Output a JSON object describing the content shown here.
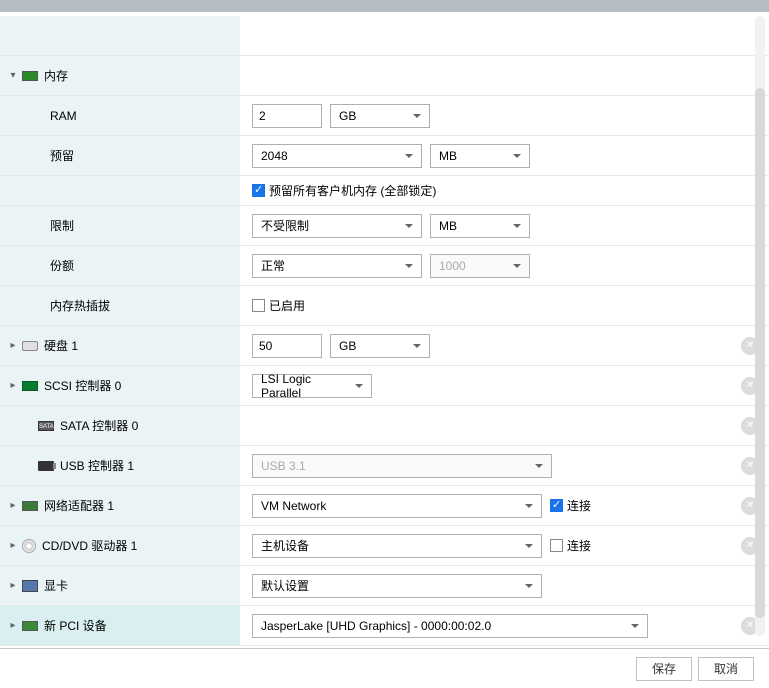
{
  "memory": {
    "label": "内存",
    "ram": {
      "label": "RAM",
      "value": "2",
      "unit": "GB"
    },
    "reservation": {
      "label": "预留",
      "value": "2048",
      "unit": "MB",
      "lock_label": "预留所有客户机内存 (全部锁定)",
      "lock_checked": true
    },
    "limit": {
      "label": "限制",
      "value": "不受限制",
      "unit": "MB"
    },
    "shares": {
      "label": "份额",
      "value": "正常",
      "count": "1000"
    },
    "hotplug": {
      "label": "内存热插拔",
      "enabled_label": "已启用",
      "checked": false
    }
  },
  "disk1": {
    "label": "硬盘 1",
    "size": "50",
    "unit": "GB"
  },
  "scsi0": {
    "label": "SCSI 控制器 0",
    "type": "LSI Logic Parallel"
  },
  "sata0": {
    "label": "SATA 控制器 0"
  },
  "usb1": {
    "label": "USB 控制器 1",
    "type": "USB 3.1"
  },
  "net1": {
    "label": "网络适配器 1",
    "network": "VM Network",
    "connect_label": "连接",
    "connected": true
  },
  "cd1": {
    "label": "CD/DVD 驱动器 1",
    "device": "主机设备",
    "connect_label": "连接",
    "connected": false
  },
  "video": {
    "label": "显卡",
    "setting": "默认设置"
  },
  "pci": {
    "label": "新 PCI 设备",
    "device": "JasperLake [UHD Graphics] - 0000:00:02.0"
  },
  "footer": {
    "save": "保存",
    "cancel": "取消"
  }
}
